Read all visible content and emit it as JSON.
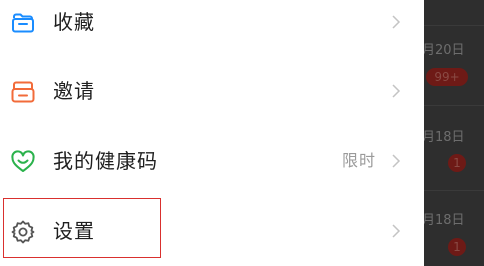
{
  "menu": {
    "items": [
      {
        "label": "收藏",
        "icon": "folder-icon",
        "trailing": ""
      },
      {
        "label": "邀请",
        "icon": "invite-card-icon",
        "trailing": ""
      },
      {
        "label": "我的健康码",
        "icon": "health-code-heart-icon",
        "trailing": "限时"
      },
      {
        "label": "设置",
        "icon": "gear-icon",
        "trailing": ""
      }
    ]
  },
  "background_list": {
    "rows": [
      {
        "date": "月20日",
        "badge": "99+"
      },
      {
        "date": "月18日",
        "badge": "1"
      },
      {
        "date": "月18日",
        "badge": "1"
      }
    ]
  },
  "colors": {
    "folder_icon": "#1a8cff",
    "invite_icon": "#f26b3a",
    "health_icon": "#2bb24c",
    "settings_icon": "#555555",
    "highlight_border": "#d9302e",
    "chevron": "#c4c4c4"
  }
}
